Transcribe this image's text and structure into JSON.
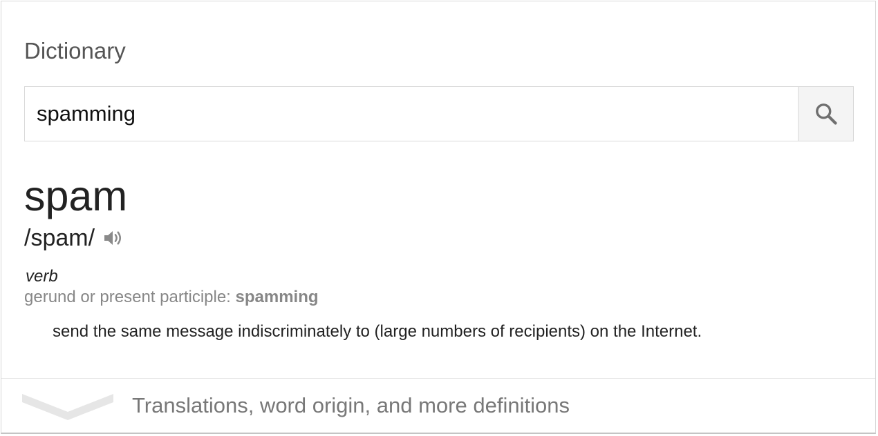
{
  "card": {
    "title": "Dictionary"
  },
  "search": {
    "value": "spamming",
    "icon": "search-icon"
  },
  "entry": {
    "headword": "spam",
    "pronunciation": "/spam/",
    "audio_icon": "speaker-icon",
    "part_of_speech": "verb",
    "inflection_label": "gerund or present participle: ",
    "inflection_form": "spamming",
    "definition": "send the same message indiscriminately to (large numbers of recipients) on the Internet."
  },
  "more": {
    "label": "Translations, word origin, and more definitions",
    "icon": "chevron-down-icon"
  },
  "colors": {
    "muted_text": "#878787",
    "border": "#d9d9d9",
    "button_bg": "#f4f4f4"
  }
}
